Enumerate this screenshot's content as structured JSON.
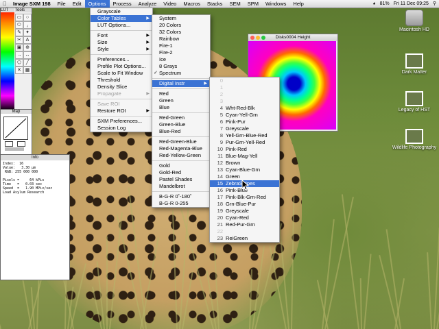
{
  "menubar": {
    "apple_icon": "apple-icon",
    "items": [
      "Image SXM 198",
      "File",
      "Edit",
      "Options",
      "Process",
      "Analyze",
      "Video",
      "Macros",
      "Stacks",
      "SEM",
      "SPM",
      "Windows",
      "Help"
    ],
    "status": {
      "battery": "81%",
      "clock": "Fri 11 Dec 09:25"
    }
  },
  "tools_window": {
    "lut_title": "LUT",
    "tools_title": "Tools",
    "tool_glyphs": [
      "▭",
      "○",
      "⬭",
      "⁁",
      "✎",
      "✦",
      "✂",
      "A",
      "▣",
      "⊕",
      "→",
      "↔",
      "⬠",
      "╱",
      "✕",
      "▦"
    ]
  },
  "map_window": {
    "title": "Map"
  },
  "info_window": {
    "title": "Info",
    "lines": [
      "Index:  16",
      "Value:   3.30 µm",
      " RGB: 255 000 000",
      "",
      "Pixels =     64 kPix",
      "Time   =   0.03 sec",
      "Speed  =   1.90 MPix/sec",
      "Load Asylum Research"
    ]
  },
  "image_window": {
    "title": "Disks0004 Height"
  },
  "options_menu": {
    "items": [
      {
        "label": "Grayscale"
      },
      {
        "label": "Color Tables",
        "highlight": true,
        "arrow": true
      },
      {
        "label": "LUT Options..."
      },
      {
        "sep": true
      },
      {
        "label": "Font",
        "arrow": true
      },
      {
        "label": "Size",
        "arrow": true
      },
      {
        "label": "Style",
        "arrow": true
      },
      {
        "sep": true
      },
      {
        "label": "Preferences..."
      },
      {
        "label": "Profile Plot Options..."
      },
      {
        "label": "Scale to Fit Window"
      },
      {
        "label": "Threshold"
      },
      {
        "label": "Density Slice"
      },
      {
        "label": "Propagate",
        "arrow": true,
        "dim": true
      },
      {
        "sep": true
      },
      {
        "label": "Save ROI",
        "dim": true
      },
      {
        "label": "Restore ROI",
        "arrow": true
      },
      {
        "sep": true
      },
      {
        "label": "SXM Preferences..."
      },
      {
        "label": "Session Log"
      }
    ]
  },
  "color_tables_menu": {
    "items": [
      {
        "label": "System"
      },
      {
        "label": "20 Colors"
      },
      {
        "label": "32 Colors"
      },
      {
        "label": "Rainbow"
      },
      {
        "label": "Fire-1"
      },
      {
        "label": "Fire-2"
      },
      {
        "label": "Ice"
      },
      {
        "label": "8 Grays"
      },
      {
        "label": "Spectrum",
        "check": true
      },
      {
        "sep": true
      },
      {
        "label": "Digital Instr",
        "highlight": true,
        "arrow": true
      },
      {
        "sep": true
      },
      {
        "label": "Red"
      },
      {
        "label": "Green"
      },
      {
        "label": "Blue"
      },
      {
        "sep": true
      },
      {
        "label": "Red-Green"
      },
      {
        "label": "Green-Blue"
      },
      {
        "label": "Blue-Red"
      },
      {
        "sep": true
      },
      {
        "label": "Red-Green-Blue"
      },
      {
        "label": "Red-Magenta-Blue"
      },
      {
        "label": "Red-Yellow-Green"
      },
      {
        "sep": true
      },
      {
        "label": "Gold"
      },
      {
        "label": "Gold-Red"
      },
      {
        "label": "Pastel Shades"
      },
      {
        "label": "Mandelbrot"
      },
      {
        "sep": true
      },
      {
        "label": "B-G-R 0˚-180˚"
      },
      {
        "label": "B-G-R 0-255"
      }
    ]
  },
  "digital_menu": {
    "items": [
      {
        "num": "0",
        "label": "",
        "gray": true
      },
      {
        "num": "1",
        "label": "",
        "gray": true
      },
      {
        "num": "2",
        "label": "",
        "gray": true
      },
      {
        "num": "3",
        "label": "",
        "gray": true
      },
      {
        "num": "4",
        "label": "Wht-Red-Blk"
      },
      {
        "num": "5",
        "label": "Cyan-Yell-Grn"
      },
      {
        "num": "6",
        "label": "Pink-Pur"
      },
      {
        "num": "7",
        "label": "Greyscale"
      },
      {
        "num": "8",
        "label": "Yell-Grn-Blue-Red"
      },
      {
        "num": "9",
        "label": "Pur-Grn-Yell-Red"
      },
      {
        "num": "10",
        "label": "Pink-Red"
      },
      {
        "num": "11",
        "label": "Blue-Mag-Yell"
      },
      {
        "num": "12",
        "label": "Brown"
      },
      {
        "num": "13",
        "label": "Cyan-Blue-Grn"
      },
      {
        "num": "14",
        "label": "Green"
      },
      {
        "num": "15",
        "label": "ZebraStripes",
        "highlight": true
      },
      {
        "num": "16",
        "label": "Pink-Blue"
      },
      {
        "num": "17",
        "label": "Pink-Blk-Grn-Red"
      },
      {
        "num": "18",
        "label": "Grn-Blue-Pur"
      },
      {
        "num": "19",
        "label": "Greyscale"
      },
      {
        "num": "20",
        "label": "Cyan-Red"
      },
      {
        "num": "21",
        "label": "Red-Pur-Grn"
      },
      {
        "num": "22",
        "label": "",
        "gray": true
      },
      {
        "num": "23",
        "label": "ReiGreen"
      }
    ]
  },
  "desktop_icons": [
    {
      "label": "Macintosh HD",
      "kind": "hdd"
    },
    {
      "label": "Dark Matter",
      "kind": "pic"
    },
    {
      "label": "Legacy of HST",
      "kind": "pic"
    },
    {
      "label": "Wildlife Photography",
      "kind": "pic"
    }
  ],
  "colors": {
    "accent": "#3b73d4",
    "menu_bg": "#f5f5f5"
  }
}
